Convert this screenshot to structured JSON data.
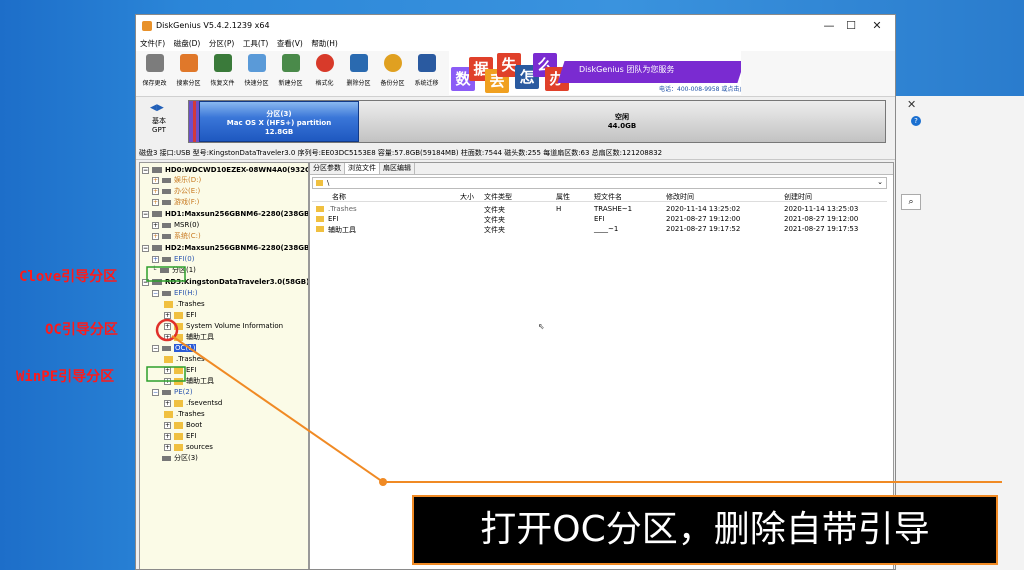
{
  "window": {
    "title": "DiskGenius V5.4.2.1239 x64",
    "controls": [
      "—",
      "☐",
      "✕"
    ]
  },
  "menu": [
    "文件(F)",
    "磁盘(D)",
    "分区(P)",
    "工具(T)",
    "查看(V)",
    "帮助(H)"
  ],
  "toolbar": [
    {
      "label": "保存更改",
      "icon": "save-icon",
      "color": "#7c7c7c"
    },
    {
      "label": "搜索分区",
      "icon": "search-icon",
      "color": "#e0782a"
    },
    {
      "label": "恢复文件",
      "icon": "recover-icon",
      "color": "#3a7a3a"
    },
    {
      "label": "快速分区",
      "icon": "quick-partition-icon",
      "color": "#5a9ad8"
    },
    {
      "label": "新建分区",
      "icon": "new-partition-icon",
      "color": "#4a8a4a"
    },
    {
      "label": "格式化",
      "icon": "format-icon",
      "color": "#d83a2a"
    },
    {
      "label": "删除分区",
      "icon": "delete-icon",
      "color": "#2a6ab0"
    },
    {
      "label": "备份分区",
      "icon": "backup-icon",
      "color": "#e0a020"
    },
    {
      "label": "系统迁移",
      "icon": "migrate-icon",
      "color": "#2a5aa0"
    }
  ],
  "banner": {
    "chars": [
      "数",
      "据",
      "丢",
      "失",
      "怎",
      "么",
      "办"
    ],
    "slogan": "DiskGenius 团队为您服务",
    "phone": "电话：400-008-9958  或点击此处添加QQ咨询"
  },
  "diskmap": {
    "mode_line1": "基本",
    "mode_line2": "GPT",
    "partition": {
      "name": "分区(3)",
      "fs": "Mac OS X (HFS+) partition",
      "size": "12.8GB"
    },
    "free": {
      "name": "空闲",
      "size": "44.0GB"
    }
  },
  "disk_info": "磁盘3 接口:USB  型号:KingstonDataTraveler3.0  序列号:EE03DC5153E8  容量:57.8GB(59184MB)  柱面数:7544  磁头数:255  每道扇区数:63  总扇区数:121208832",
  "tree": {
    "hd0": "HD0:WDCWD10EZEX-08WN4A0(932G",
    "hd0_items": [
      "娱乐(D:)",
      "办公(E:)",
      "游戏(F:)"
    ],
    "hd1": "HD1:Maxsun256GBNM6-2280(238GB)",
    "hd1_items": [
      "MSR(0)",
      "系统(C:)"
    ],
    "hd2": "HD2:Maxsun256GBNM6-2280(238GB)",
    "hd2_items": [
      "EFI(0)",
      "分区(1)"
    ],
    "rd3": "RD3:KingstonDataTraveler3.0(58GB)",
    "efi_h": "EFI(H:)",
    "efi_h_children": [
      ".Trashes",
      "EFI",
      "System Volume Information",
      "辅助工具"
    ],
    "oc": "OC(1)",
    "oc_children": [
      ".Trashes",
      "EFI",
      "辅助工具"
    ],
    "pe": "PE(2)",
    "pe_children": [
      ".fseventsd",
      ".Trashes",
      "Boot",
      "EFI",
      "sources"
    ],
    "part3": "分区(3)"
  },
  "right_tabs": [
    "分区参数",
    "浏览文件",
    "扇区编辑"
  ],
  "path": "\\",
  "columns": [
    "名称",
    "大小",
    "文件类型",
    "属性",
    "短文件名",
    "修改时间",
    "创建时间"
  ],
  "files": [
    {
      "name": ".Trashes",
      "size": "",
      "type": "文件夹",
      "attr": "H",
      "short": "TRASHE~1",
      "modified": "2020-11-14 13:25:02",
      "created": "2020-11-14 13:25:03"
    },
    {
      "name": "EFI",
      "size": "",
      "type": "文件夹",
      "attr": "",
      "short": "EFI",
      "modified": "2021-08-27 19:12:00",
      "created": "2021-08-27 19:12:00"
    },
    {
      "name": "辅助工具",
      "size": "",
      "type": "文件夹",
      "attr": "",
      "short": "____~1",
      "modified": "2021-08-27 19:17:52",
      "created": "2021-08-27 19:17:53"
    }
  ],
  "annotations": {
    "clove": "Clove引导分区",
    "oc": "OC引导分区",
    "winpe": "WinPE引导分区"
  },
  "caption": "打开OC分区，删除自带引导",
  "colors": {
    "accent": "#f08a24",
    "annotation": "#ff1a1a",
    "highlight": "#2a5bd6",
    "box_green": "#2ca02c"
  }
}
